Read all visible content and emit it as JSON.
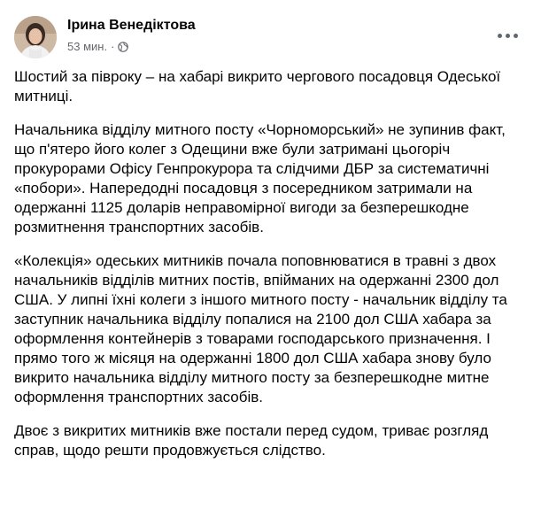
{
  "post": {
    "author": "Ірина Венедіктова",
    "time": "53 мин.",
    "separator": "·",
    "privacy_icon": "globe-icon",
    "more_icon": "more-options-icon",
    "paragraphs": [
      "Шостий за півроку – на хабарі викрито чергового посадовця Одеської митниці.",
      "Начальника відділу митного посту «Чорноморський» не зупинив факт, що п'ятеро його колег з Одещини вже були затримані цьогоріч прокурорами Офісу Генпрокурора та слідчими ДБР за систематичні «побори». Напередодні посадовця з посередником затримали на одержанні 1125 доларів неправомірної вигоди за безперешкодне розмитнення транспортних засобів.",
      "«Колекція» одеських митників почала поповнюватися в травні з двох начальників відділів митних постів, впійманих на одержанні 2300 дол США. У липні їхні колеги з іншого митного посту - начальник відділу та заступник начальника відділу попалися на 2100 дол США хабара за оформлення контейнерів з товарами господарського призначення. І прямо того ж місяця на одержанні 1800 дол США хабара знову було викрито начальника відділу митного посту за безперешкодне митне оформлення транспортних засобів.",
      "Двоє з викритих митників вже постали перед судом, триває розгляд справ, щодо решти продовжується слідство."
    ]
  }
}
